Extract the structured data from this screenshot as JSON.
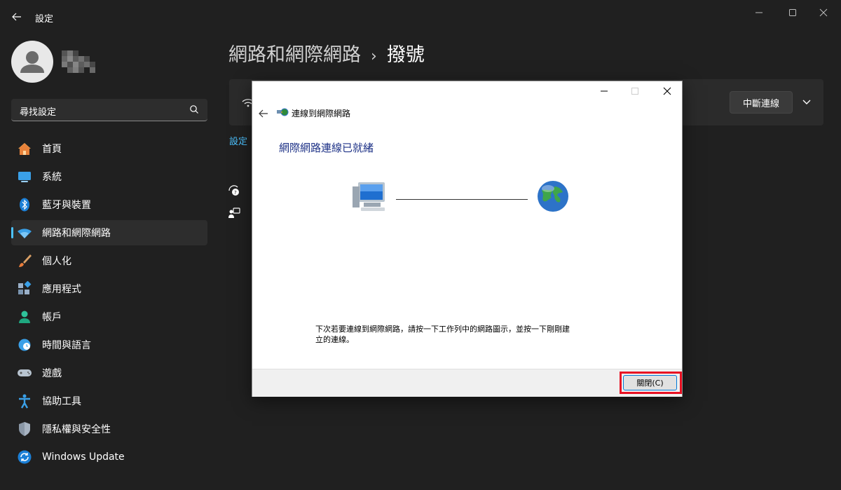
{
  "window": {
    "title": "設定"
  },
  "search": {
    "placeholder": "尋找設定"
  },
  "sidebar": {
    "items": [
      {
        "label": "首頁",
        "icon": "home-icon"
      },
      {
        "label": "系統",
        "icon": "system-icon"
      },
      {
        "label": "藍牙與裝置",
        "icon": "bluetooth-icon"
      },
      {
        "label": "網路和網際網路",
        "icon": "wifi-icon",
        "selected": true
      },
      {
        "label": "個人化",
        "icon": "brush-icon"
      },
      {
        "label": "應用程式",
        "icon": "apps-icon"
      },
      {
        "label": "帳戶",
        "icon": "account-icon"
      },
      {
        "label": "時間與語言",
        "icon": "time-language-icon"
      },
      {
        "label": "遊戲",
        "icon": "gaming-icon"
      },
      {
        "label": "協助工具",
        "icon": "accessibility-icon"
      },
      {
        "label": "隱私權與安全性",
        "icon": "shield-icon"
      },
      {
        "label": "Windows Update",
        "icon": "update-icon"
      }
    ]
  },
  "main": {
    "breadcrumb_parent": "網路和網際網路",
    "breadcrumb_sep": "›",
    "breadcrumb_current": "撥號",
    "disconnect_label": "中斷連線",
    "settings_link": "設定"
  },
  "dialog": {
    "title": "連線到網際網路",
    "heading": "網際網路連線已就緒",
    "message": "下次若要連線到網際網路，請按一下工作列中的網路圖示，並按一下剛剛建立的連線。",
    "close_label": "關閉(C)"
  },
  "colors": {
    "accent": "#4cc2ff",
    "highlight": "#e81123",
    "heading": "#1e3287"
  }
}
